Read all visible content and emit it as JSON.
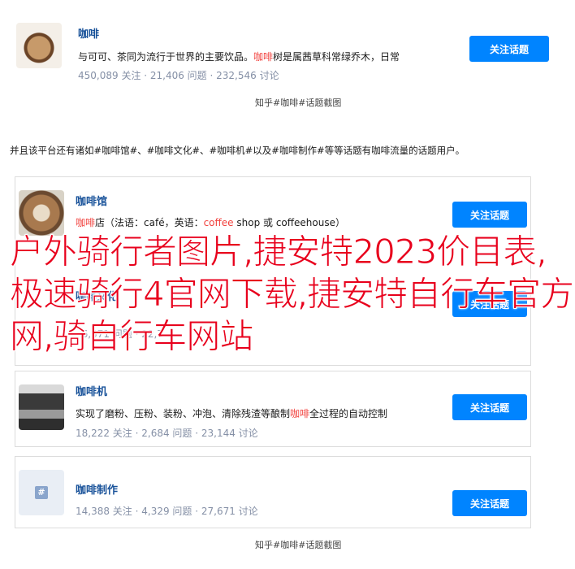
{
  "topics": [
    {
      "title": "咖啡",
      "desc_before": "与可可、茶同为流行于世界的主要饮品。",
      "desc_hl": "咖啡",
      "desc_after": "树是属茜草科常绿乔木，日常",
      "stats": "450,089 关注  ·  21,406 问题  ·  232,546 讨论",
      "button": "关注话题"
    },
    {
      "title": "咖啡馆",
      "desc_before": "",
      "desc_hl": "咖啡",
      "desc_after": "店（法语：café，英语：",
      "desc_hl2": "coffee",
      "desc_after2": " shop 或 coffeehouse）",
      "button": "关注话题"
    },
    {
      "title": "咖啡文化",
      "stats": "· 6,371 问题 · 22,7",
      "button": "关注话题"
    },
    {
      "title": "咖啡机",
      "desc_before": "实现了磨粉、压粉、装粉、冲泡、清除残渣等酿制",
      "desc_hl": "咖啡",
      "desc_after": "全过程的自动控制",
      "stats": "18,222 关注  ·  2,684 问题  ·  23,144 讨论",
      "button": "关注话题"
    },
    {
      "title": "咖啡制作",
      "stats": "14,388 关注  ·  4,329 问题  ·  27,671 讨论",
      "button": "关注话题"
    }
  ],
  "caption_top": "知乎#咖啡#话题截图",
  "caption_bottom": "知乎#咖啡#话题截图",
  "paragraph": "并且该平台还有诸如#咖啡馆#、#咖啡文化#、#咖啡机#以及#咖啡制作#等等话题有咖啡流量的话题用户。",
  "overlay_text": "户外骑行者图片,捷安特2023价目表,极速骑行4官网下载,捷安特自行车官方网,骑自行车网站",
  "colors": {
    "accent": "#0084ff",
    "link": "#175199",
    "highlight": "#f1403c",
    "overlay": "#e8001c"
  }
}
